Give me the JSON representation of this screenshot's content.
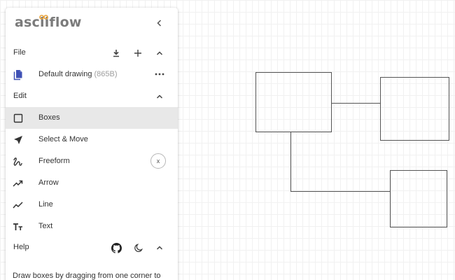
{
  "app": {
    "logo_text": "asciiflow",
    "accent_color": "#e8a23a"
  },
  "file_section": {
    "label": "File",
    "icons": [
      "download-icon",
      "add-icon",
      "chevron-up-icon"
    ],
    "drawing": {
      "name": "Default drawing",
      "size": "(865B)"
    }
  },
  "edit_section": {
    "label": "Edit",
    "tools": [
      {
        "label": "Boxes",
        "icon": "square-icon",
        "selected": true
      },
      {
        "label": "Select & Move",
        "icon": "navigation-arrow-icon",
        "selected": false
      },
      {
        "label": "Freeform",
        "icon": "gesture-icon",
        "selected": false,
        "action": "x"
      },
      {
        "label": "Arrow",
        "icon": "trending-up-icon",
        "selected": false
      },
      {
        "label": "Line",
        "icon": "show-chart-icon",
        "selected": false
      },
      {
        "label": "Text",
        "icon": "text-fields-icon",
        "selected": false
      }
    ]
  },
  "help_section": {
    "label": "Help",
    "icons": [
      "github-icon",
      "dark-mode-icon",
      "chevron-up-icon"
    ],
    "text": "Draw boxes by dragging from one corner to"
  },
  "colors": {
    "selected_row": "#e8e8e8",
    "icon": "#555555",
    "drawing_stroke": "#555555"
  }
}
